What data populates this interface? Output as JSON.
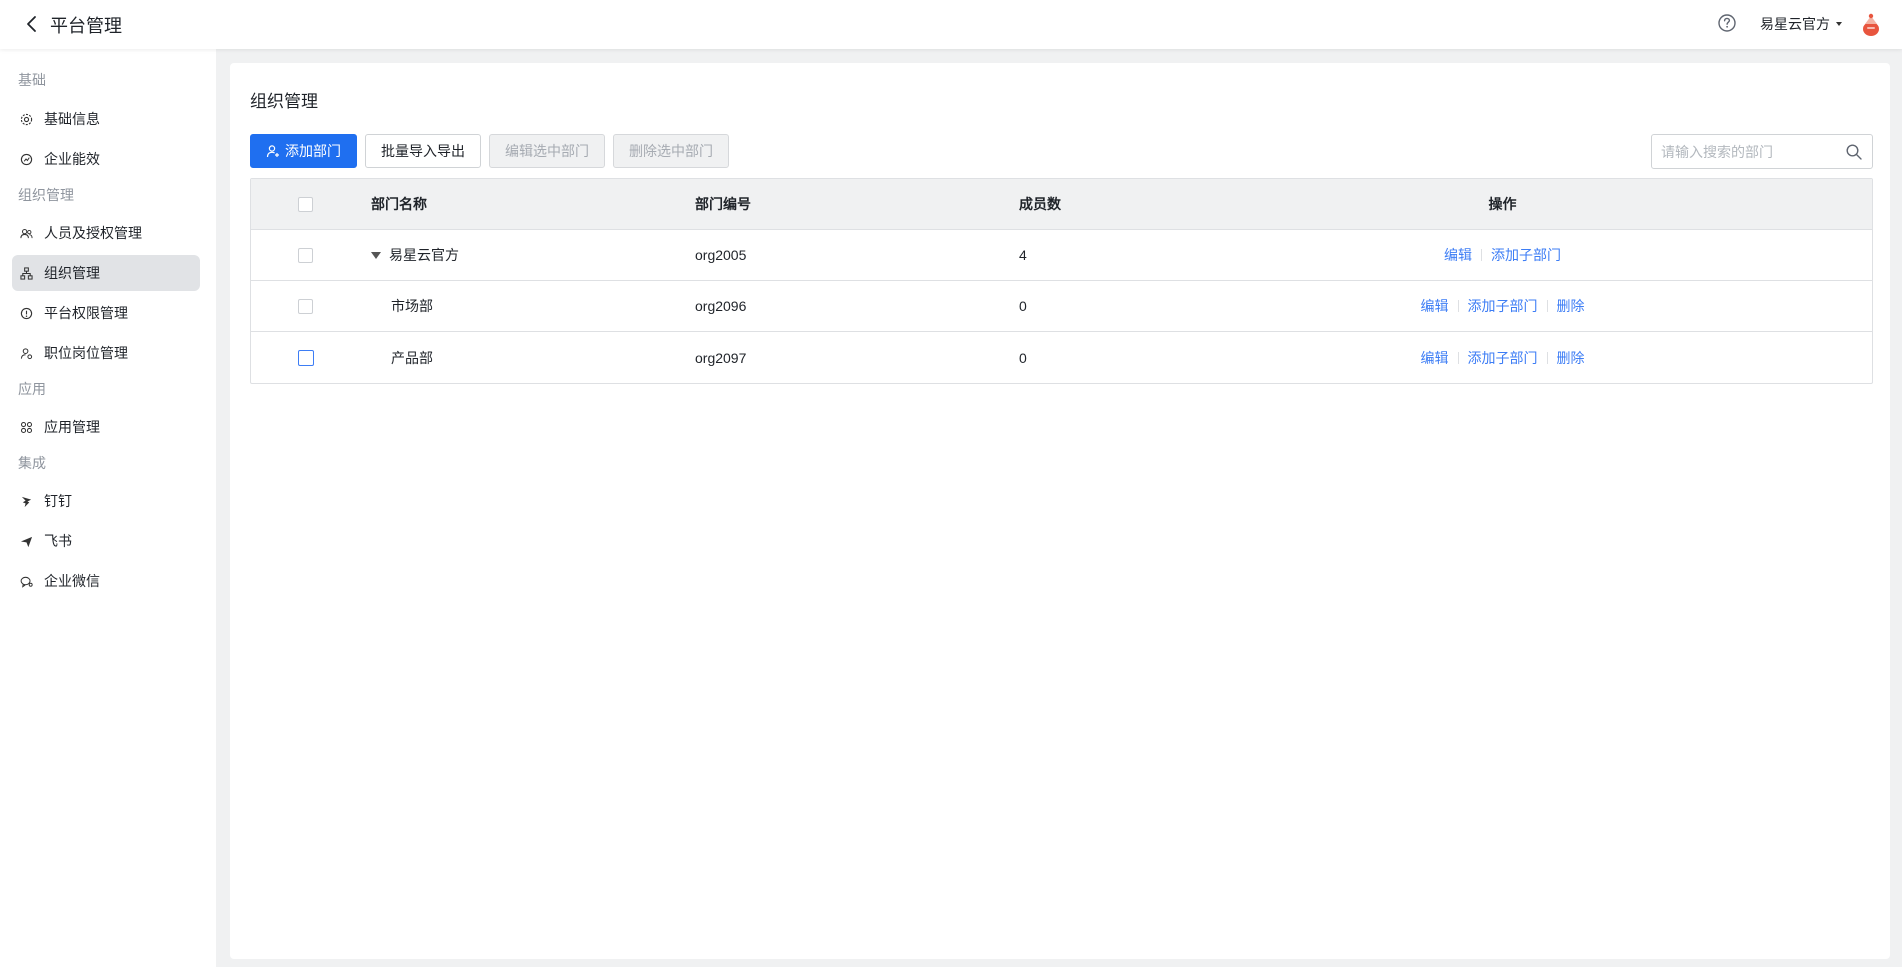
{
  "header": {
    "title": "平台管理",
    "org_name": "易星云官方"
  },
  "sidebar": {
    "groups": {
      "basic": "基础",
      "org": "组织管理",
      "app": "应用",
      "integration": "集成"
    },
    "items": [
      {
        "label": "基础信息",
        "icon": "gear-icon"
      },
      {
        "label": "企业能效",
        "icon": "chart-icon"
      },
      {
        "label": "人员及授权管理",
        "icon": "users-icon"
      },
      {
        "label": "组织管理",
        "icon": "org-tree-icon",
        "active": true
      },
      {
        "label": "平台权限管理",
        "icon": "shield-icon"
      },
      {
        "label": "职位岗位管理",
        "icon": "user-badge-icon"
      },
      {
        "label": "应用管理",
        "icon": "apps-icon"
      },
      {
        "label": "钉钉",
        "icon": "dingtalk-icon"
      },
      {
        "label": "飞书",
        "icon": "feishu-icon"
      },
      {
        "label": "企业微信",
        "icon": "wecom-icon"
      }
    ]
  },
  "main": {
    "title": "组织管理",
    "toolbar": {
      "add_label": "添加部门",
      "import_label": "批量导入导出",
      "edit_selected_label": "编辑选中部门",
      "delete_selected_label": "删除选中部门"
    },
    "search": {
      "placeholder": "请输入搜索的部门"
    },
    "table": {
      "columns": [
        "部门名称",
        "部门编号",
        "成员数",
        "操作"
      ],
      "rows": [
        {
          "name": "易星云官方",
          "code": "org2005",
          "count": "4",
          "ops": [
            "编辑",
            "添加子部门"
          ]
        },
        {
          "name": "市场部",
          "code": "org2096",
          "count": "0",
          "ops": [
            "编辑",
            "添加子部门",
            "删除"
          ]
        },
        {
          "name": "产品部",
          "code": "org2097",
          "count": "0",
          "ops": [
            "编辑",
            "添加子部门",
            "删除"
          ]
        }
      ]
    }
  },
  "colors": {
    "primary": "#1f6ff0",
    "link": "#3d7df5",
    "sidebar_active": "#e1e3e6"
  }
}
